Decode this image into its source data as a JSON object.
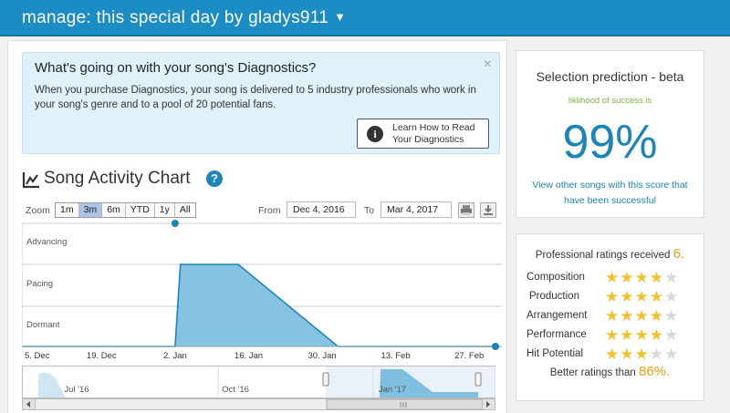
{
  "header": {
    "title": "manage: this special day by gladys911",
    "caret": "▼"
  },
  "info_box": {
    "title": "What's going on with your song's Diagnostics?",
    "body": "When you purchase Diagnostics, your song is delivered to 5 industry professionals who work in your song's genre and to a pool of 20 potential fans.",
    "close": "×",
    "button_line1": "Learn How to Read",
    "button_line2": "Your Diagnostics",
    "button_icon": "info-icon"
  },
  "activity": {
    "title": "Song Activity Chart",
    "help": "?",
    "zoom_label": "Zoom",
    "zoom_buttons": [
      "1m",
      "3m",
      "6m",
      "YTD",
      "1y",
      "All"
    ],
    "zoom_selected": "3m",
    "from_label": "From",
    "from_value": "Dec 4, 2016",
    "to_label": "To",
    "to_value": "Mar 4, 2017"
  },
  "chart_data": {
    "type": "area",
    "y_categories": [
      "Dormant",
      "Pacing",
      "Advancing"
    ],
    "x_ticks": [
      "5. Dec",
      "19. Dec",
      "2. Jan",
      "16. Jan",
      "30. Jan",
      "13. Feb",
      "27. Feb"
    ],
    "series": [
      {
        "x": [
          "2016-12-04",
          "2017-01-02",
          "2017-01-03",
          "2017-01-14",
          "2017-02-02",
          "2017-03-04"
        ],
        "y": [
          "Dormant",
          "Dormant",
          "Advancing",
          "Advancing",
          "Dormant",
          "Dormant"
        ]
      }
    ],
    "navigator": {
      "labels": [
        "Jul '16",
        "Oct '16",
        "Jan '17"
      ]
    },
    "color": "#7fbfe0",
    "line_color": "#1b85b8"
  },
  "prediction": {
    "title": "Selection prediction - beta",
    "subtitle": "liklihood of success is",
    "value": "99%",
    "link": "View other songs with this score that have been successful"
  },
  "ratings": {
    "received_label": "Professional ratings received",
    "received_count": "6.",
    "items": [
      {
        "label": "Composition",
        "stars": 4
      },
      {
        "label": "Production",
        "stars": 4
      },
      {
        "label": "Arrangement",
        "stars": 4
      },
      {
        "label": "Performance",
        "stars": 4
      },
      {
        "label": "Hit Potential",
        "stars": 3
      }
    ],
    "better_label": "Better ratings than",
    "better_value": "86%."
  }
}
